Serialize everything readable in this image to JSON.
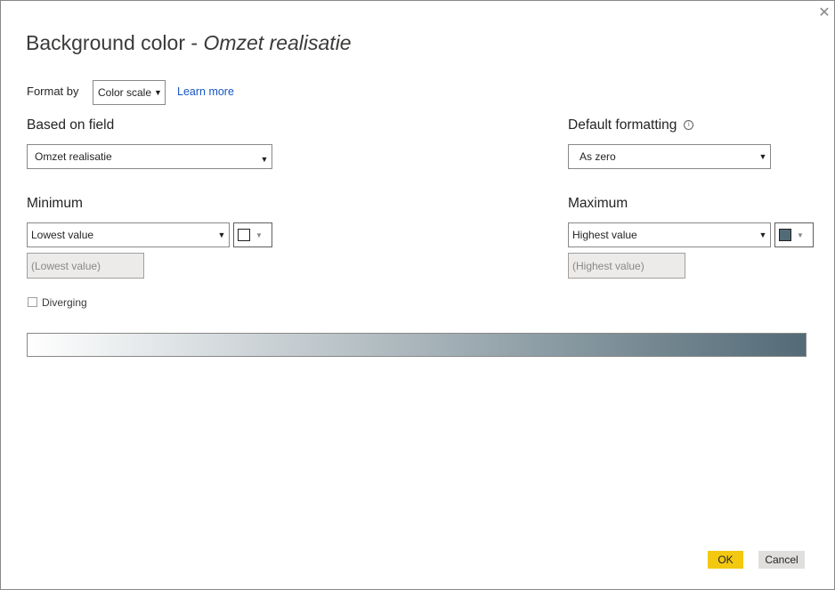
{
  "dialog": {
    "title_prefix": "Background color - ",
    "title_subject": "Omzet realisatie",
    "close_icon": "close-icon"
  },
  "format_by": {
    "label": "Format by",
    "value": "Color scale",
    "learn_more": "Learn more"
  },
  "based_on_field": {
    "label": "Based on field",
    "value": "Omzet realisatie"
  },
  "default_formatting": {
    "label": "Default formatting",
    "info_icon": "info-icon",
    "value": "As zero"
  },
  "minimum": {
    "label": "Minimum",
    "type_value": "Lowest value",
    "input_placeholder": "(Lowest value)",
    "color": "#ffffff"
  },
  "maximum": {
    "label": "Maximum",
    "type_value": "Highest value",
    "input_placeholder": "(Highest value)",
    "color": "#536b77"
  },
  "diverging": {
    "label": "Diverging",
    "checked": false
  },
  "gradient": {
    "from_color": "#ffffff",
    "to_color": "#536b77"
  },
  "footer": {
    "ok_label": "OK",
    "cancel_label": "Cancel"
  },
  "colors": {
    "accent": "#f2c811",
    "link": "#1755c4"
  }
}
